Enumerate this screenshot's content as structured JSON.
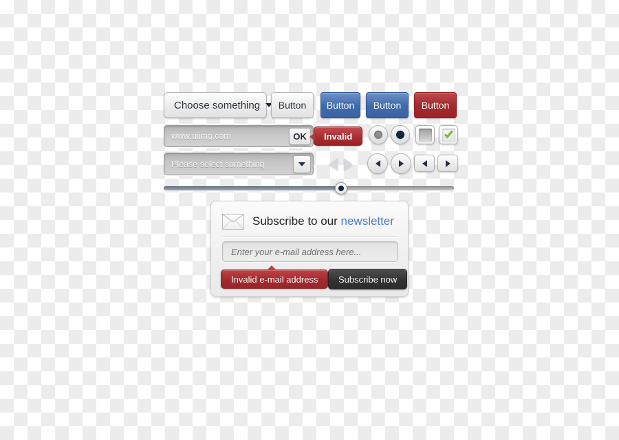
{
  "toolbar": {
    "dropdown_label": "Choose something",
    "dropdown_icon": "chevron-down-icon",
    "buttons": [
      {
        "label": "Button",
        "style": "grey"
      },
      {
        "label": "Button",
        "style": "blue"
      },
      {
        "label": "Button",
        "style": "blue"
      },
      {
        "label": "Button",
        "style": "red"
      }
    ]
  },
  "form_row": {
    "url_input_value": "www.uiimg.com",
    "url_input_placeholder": "www.uiimg.com",
    "ok_label": "OK",
    "invalid_label": "Invalid",
    "radio_unselected_icon": "radio-button-icon",
    "radio_selected_icon": "radio-button-selected-icon",
    "checkbox_unchecked_icon": "checkbox-icon",
    "checkbox_checked_icon": "checkbox-checked-icon"
  },
  "select_row": {
    "select_value": "Please select something",
    "select_placeholder": "Please select something",
    "select_arrow_icon": "chevron-down-icon",
    "nav": {
      "plain_prev_icon": "triangle-left-icon",
      "plain_next_icon": "triangle-right-icon",
      "round_prev_icon": "arrow-left-icon",
      "round_next_icon": "arrow-right-icon",
      "rect_prev_icon": "arrow-left-icon",
      "rect_next_icon": "arrow-right-icon"
    }
  },
  "slider": {
    "value_percent": 61,
    "handle_icon": "slider-handle-icon"
  },
  "newsletter": {
    "envelope_icon": "envelope-icon",
    "title_prefix": "Subscribe to our ",
    "title_accent": "newsletter",
    "email_placeholder": "Enter your e-mail address here...",
    "email_value": "",
    "error_label": "Invalid e-mail address",
    "submit_label": "Subscribe now"
  },
  "colors": {
    "blue_button": "#3f6bae",
    "red_button": "#a42a2e",
    "accent_link": "#4a7bd0",
    "dark_button": "#333333",
    "check_green": "#7cc243",
    "radio_navy": "#0d2238",
    "checker_light": "#ffffff",
    "checker_dark": "#ececec"
  }
}
